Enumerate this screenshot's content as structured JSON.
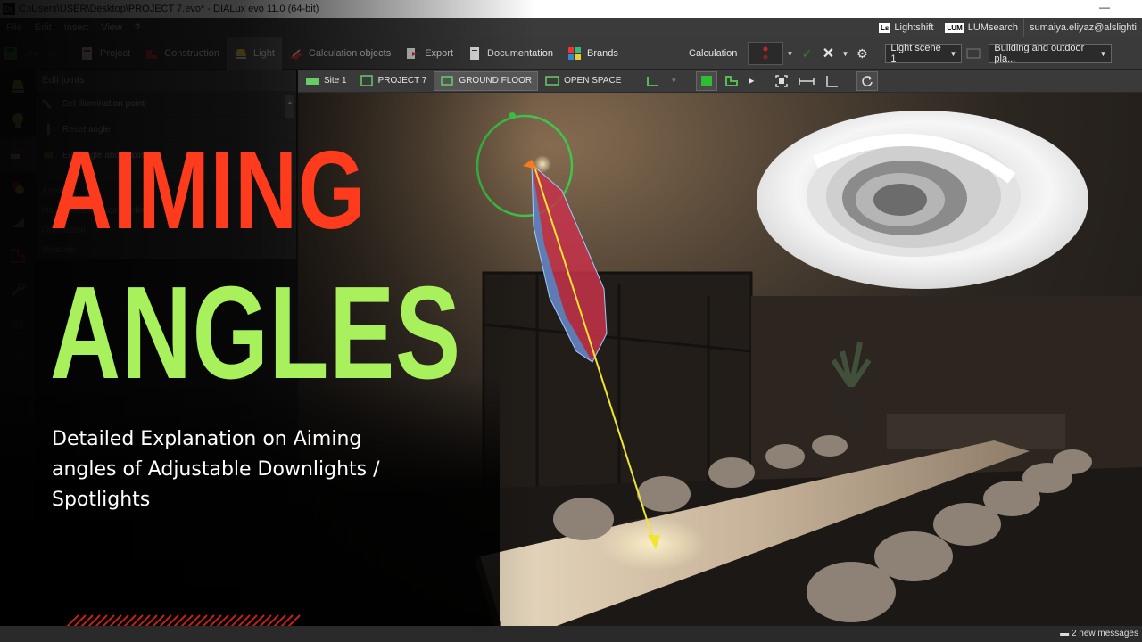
{
  "window": {
    "title": "C:\\Users\\USER\\Desktop\\PROJECT 7.evo* - DIALux evo 11.0  (64-bit)",
    "app_icon": "Dx",
    "minimize": "—"
  },
  "menubar": {
    "items": [
      "File",
      "Edit",
      "Insert",
      "View",
      "?"
    ],
    "lightshift": "Lightshift",
    "lightshift_badge": "Ls",
    "lumsearch": "LUMsearch",
    "lumsearch_badge": "LUM",
    "user": "sumaiya.eliyaz@alslighti"
  },
  "ribbon": {
    "tabs": [
      {
        "label": "Project"
      },
      {
        "label": "Construction"
      },
      {
        "label": "Light"
      },
      {
        "label": "Calculation objects"
      },
      {
        "label": "Export"
      },
      {
        "label": "Documentation"
      },
      {
        "label": "Brands"
      }
    ],
    "calculation_label": "Calculation",
    "light_scene": "Light scene 1",
    "view_select": "Building and outdoor pla..."
  },
  "panel": {
    "title": "Edit joints",
    "rows": [
      "Set illumination point",
      "Reset angle",
      "Edit angle about axis"
    ],
    "sub_rows": [
      "Aiming",
      "No illumination point defined",
      "Orientation",
      "Rotation"
    ]
  },
  "viewbar": {
    "crumbs": [
      "Site 1",
      "PROJECT 7",
      "GROUND FLOOR",
      "OPEN SPACE"
    ]
  },
  "overlay": {
    "title_line1": "AIMING",
    "title_line2": "ANGLES",
    "subtitle": "Detailed Explanation on Aiming angles of Adjustable Downlights / Spotlights",
    "colors": {
      "title1": "#ff3b1e",
      "title2": "#a8f05c",
      "stripe": "#c0201a"
    }
  },
  "status": {
    "messages": "2 new messages"
  }
}
